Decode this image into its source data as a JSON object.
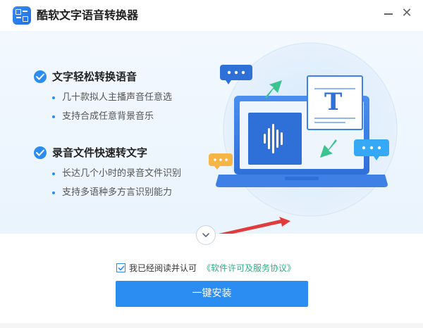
{
  "window": {
    "title": "酷软文字语音转换器"
  },
  "features": [
    {
      "title": "文字轻松转换语音",
      "bullets": [
        "几十款拟人主播声音任意选",
        "支持合成任意背景音乐"
      ]
    },
    {
      "title": "录音文件快速转文字",
      "bullets": [
        "长达几个小时的录音文件识别",
        "支持多语种多方言识别能力"
      ]
    }
  ],
  "agreement": {
    "checked": true,
    "text": "我已经阅读并认可",
    "link": "《软件许可及服务协议》"
  },
  "install": {
    "label": "一键安装"
  },
  "colors": {
    "accent": "#2b8cf2",
    "link": "#2bb07f",
    "hero_bg": "#eaf4fd"
  },
  "icons": [
    "app-logo-icon",
    "minimize-icon",
    "close-icon",
    "check-icon",
    "expand-chevron-icon",
    "checkbox-check-icon"
  ]
}
